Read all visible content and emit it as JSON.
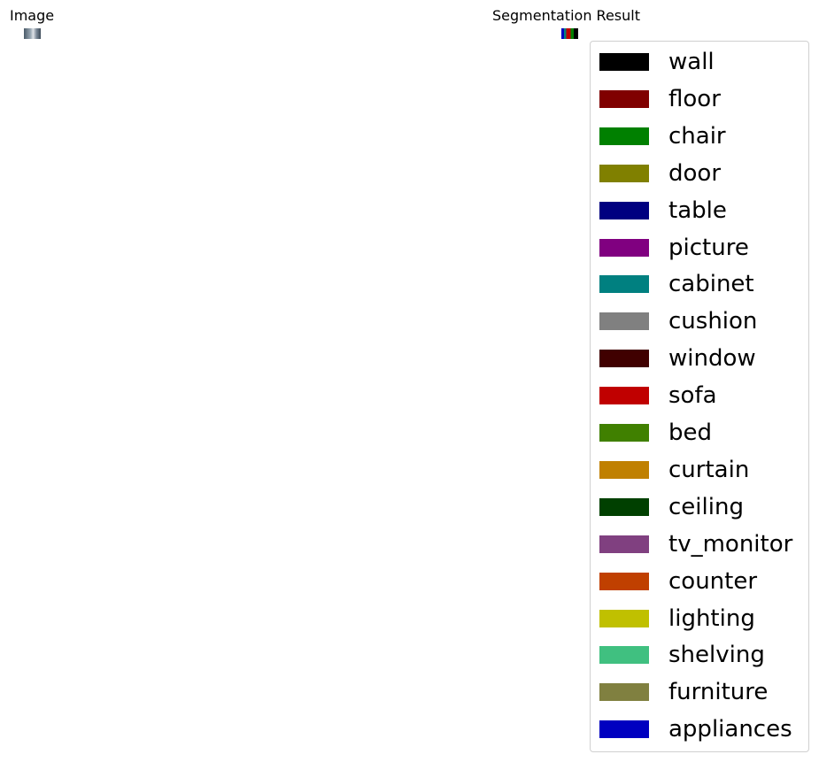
{
  "panels": {
    "image_title": "Image",
    "segmentation_title": "Segmentation Result"
  },
  "legend": [
    {
      "label": "wall",
      "color": "#000000"
    },
    {
      "label": "floor",
      "color": "#800000"
    },
    {
      "label": "chair",
      "color": "#008000"
    },
    {
      "label": "door",
      "color": "#808000"
    },
    {
      "label": "table",
      "color": "#000080"
    },
    {
      "label": "picture",
      "color": "#800080"
    },
    {
      "label": "cabinet",
      "color": "#008080"
    },
    {
      "label": "cushion",
      "color": "#808080"
    },
    {
      "label": "window",
      "color": "#400000"
    },
    {
      "label": "sofa",
      "color": "#c00000"
    },
    {
      "label": "bed",
      "color": "#408000"
    },
    {
      "label": "curtain",
      "color": "#c08000"
    },
    {
      "label": "ceiling",
      "color": "#004000"
    },
    {
      "label": "tv_monitor",
      "color": "#804080"
    },
    {
      "label": "counter",
      "color": "#c04000"
    },
    {
      "label": "lighting",
      "color": "#c0c000"
    },
    {
      "label": "shelving",
      "color": "#40c080"
    },
    {
      "label": "furniture",
      "color": "#808040"
    },
    {
      "label": "appliances",
      "color": "#0000c0"
    }
  ]
}
